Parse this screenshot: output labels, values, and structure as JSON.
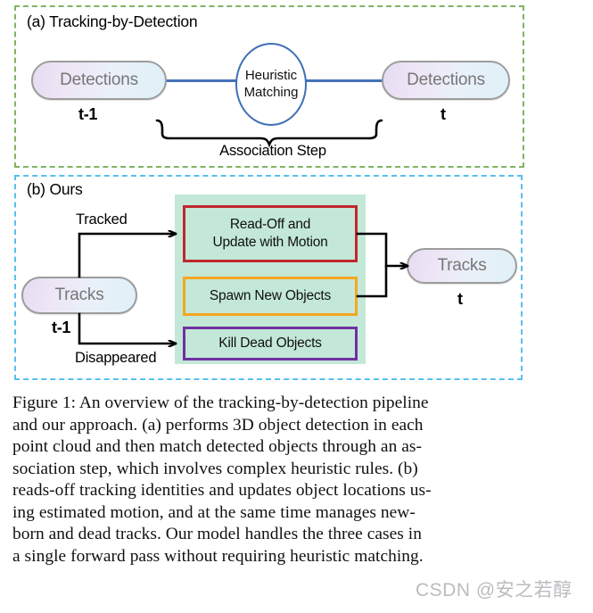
{
  "figure": {
    "panel_a": {
      "title": "(a) Tracking-by-Detection",
      "border_color": "#7fb463",
      "nodes": {
        "left_pill": "Detections",
        "left_time": "t-1",
        "ellipse_line1": "Heuristic",
        "ellipse_line2": "Matching",
        "right_pill": "Detections",
        "right_time": "t"
      },
      "brace_label": "Association Step",
      "connector_color": "#4472b8",
      "ellipse_border_color": "#3f6fb5"
    },
    "panel_b": {
      "title": "(b) Ours",
      "border_color": "#56c0ee",
      "block_color": "#c3e8d7",
      "nodes": {
        "left_pill": "Tracks",
        "left_time": "t-1",
        "right_pill": "Tracks",
        "right_time": "t"
      },
      "edge_labels": {
        "tracked": "Tracked",
        "disappeared": "Disappeared"
      },
      "boxes": [
        {
          "line1": "Read-Off and",
          "line2": "Update with Motion",
          "color": "#c1272d"
        },
        {
          "line1": "Spawn New Objects",
          "line2": "",
          "color": "#f5a623"
        },
        {
          "line1": "Kill Dead Objects",
          "line2": "",
          "color": "#7030a0"
        }
      ]
    }
  },
  "caption": {
    "lines": [
      "Figure 1: An overview of the tracking-by-detection pipeline",
      "and our approach. (a) performs 3D object detection in each",
      "point cloud and then match detected objects through an as-",
      "sociation step, which involves complex heuristic rules. (b)",
      "reads-off tracking identities and updates object locations us-",
      "ing estimated motion, and at the same time manages new-",
      "born and dead tracks. Our model handles the three cases in",
      "a single forward pass without requiring heuristic matching."
    ]
  },
  "watermark": {
    "text": "CSDN @安之若醇"
  }
}
